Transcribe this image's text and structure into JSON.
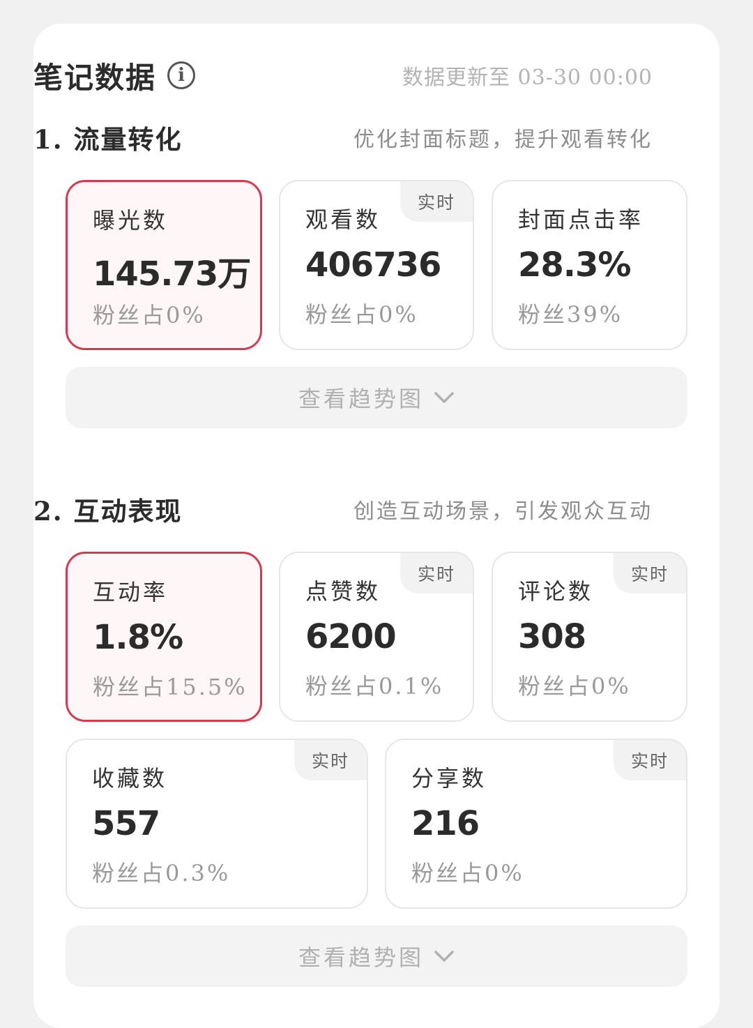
{
  "header": {
    "title": "笔记数据",
    "info_icon": "info-icon",
    "info_glyph": "i",
    "update_time": "数据更新至 03-30 00:00"
  },
  "sections": [
    {
      "title": "1. 流量转化",
      "hint": "优化封面标题，提升观看转化",
      "metrics": [
        {
          "label": "曝光数",
          "value": "145.73万",
          "sub": "粉丝占0%",
          "selected": true,
          "badge": ""
        },
        {
          "label": "观看数",
          "value": "406736",
          "sub": "粉丝占0%",
          "selected": false,
          "badge": "实时"
        },
        {
          "label": "封面点击率",
          "value": "28.3%",
          "sub": "粉丝39%",
          "selected": false,
          "badge": ""
        }
      ],
      "trend_label": "查看趋势图"
    },
    {
      "title": "2. 互动表现",
      "hint": "创造互动场景，引发观众互动",
      "metrics": [
        {
          "label": "互动率",
          "value": "1.8%",
          "sub": "粉丝占15.5%",
          "selected": true,
          "badge": ""
        },
        {
          "label": "点赞数",
          "value": "6200",
          "sub": "粉丝占0.1%",
          "selected": false,
          "badge": "实时"
        },
        {
          "label": "评论数",
          "value": "308",
          "sub": "粉丝占0%",
          "selected": false,
          "badge": "实时"
        },
        {
          "label": "收藏数",
          "value": "557",
          "sub": "粉丝占0.3%",
          "selected": false,
          "badge": "实时"
        },
        {
          "label": "分享数",
          "value": "216",
          "sub": "粉丝占0%",
          "selected": false,
          "badge": "实时"
        }
      ],
      "trend_label": "查看趋势图"
    }
  ],
  "colors": {
    "accent": "#d9394f",
    "selected_bg": "#fff6f7",
    "badge_bg": "#f2f2f2"
  }
}
